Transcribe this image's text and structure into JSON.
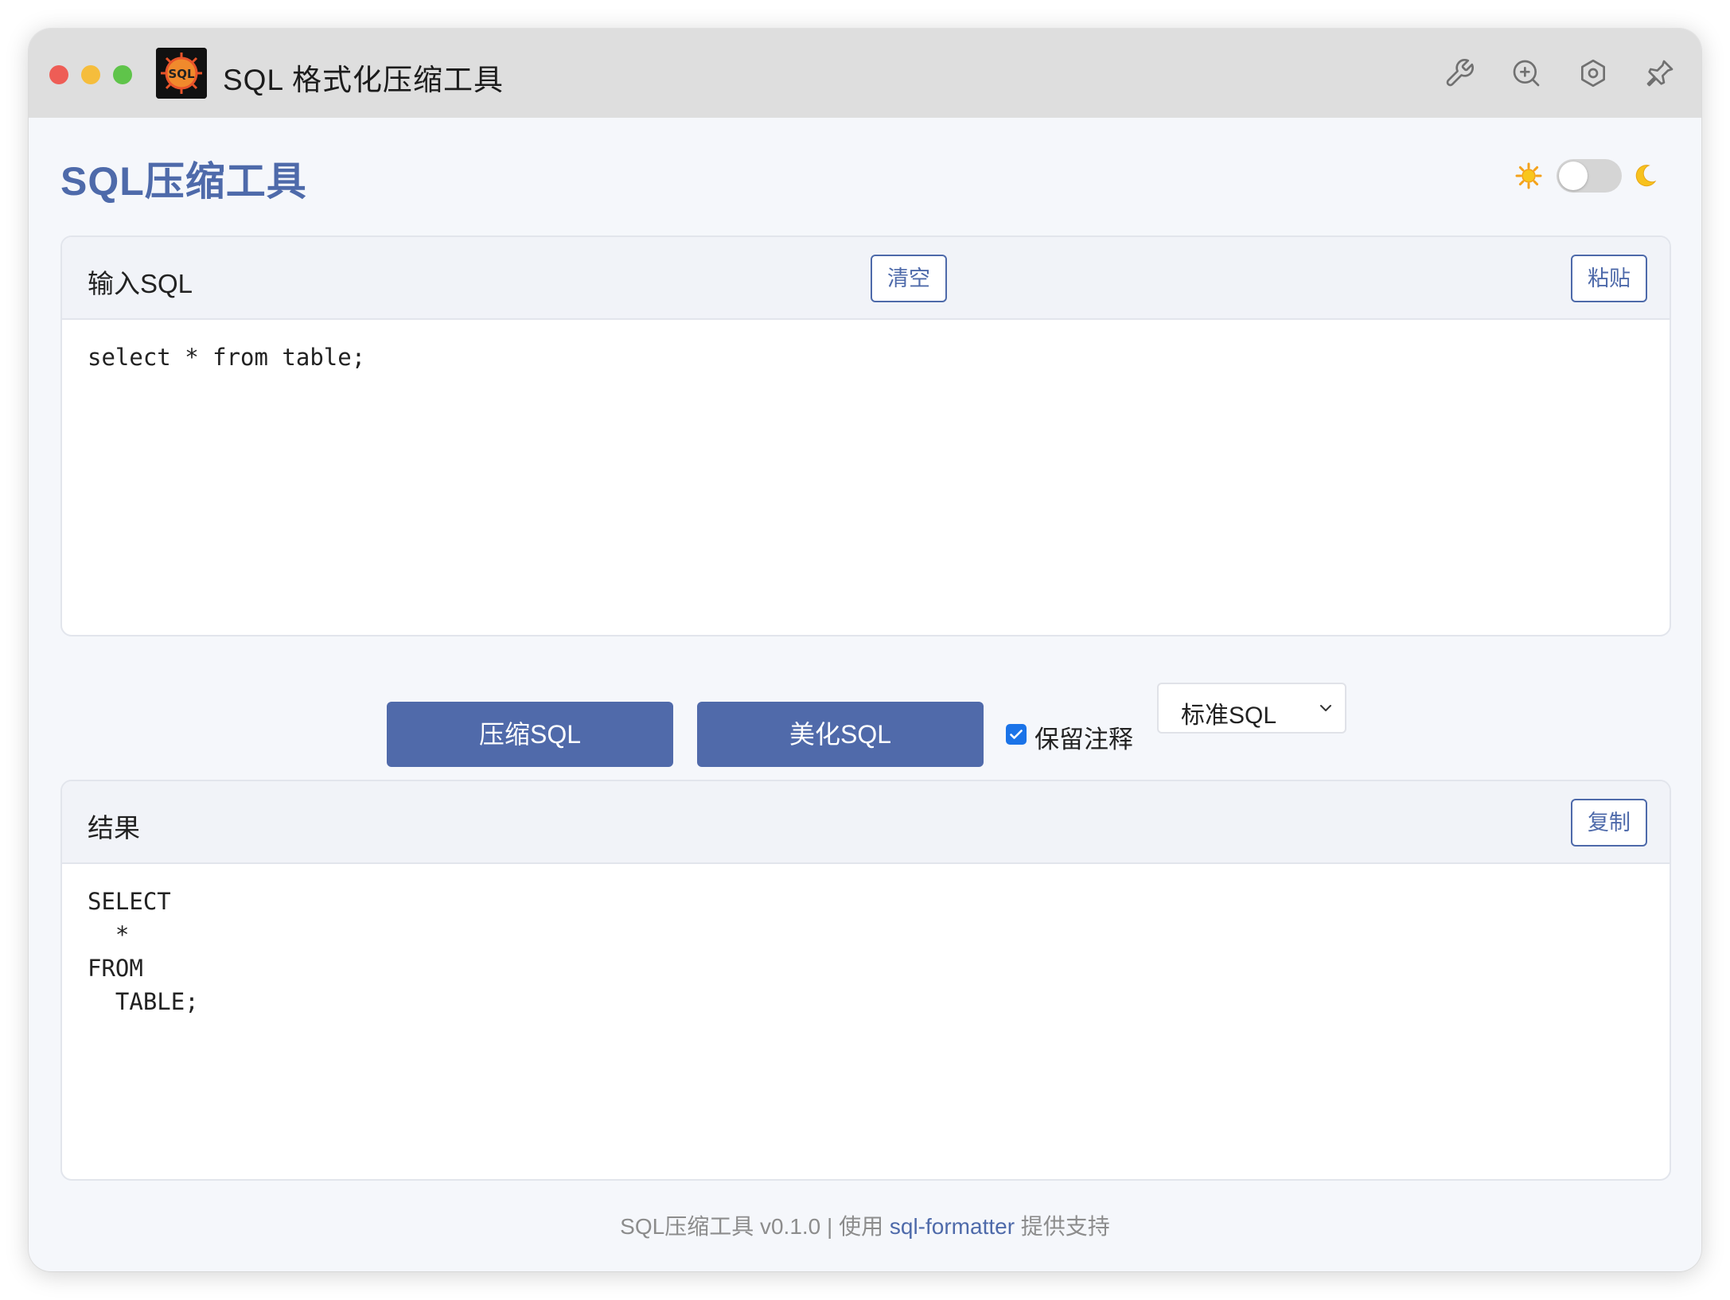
{
  "window": {
    "app_title": "SQL 格式化压缩工具",
    "toolbar_icons": [
      "wrench-icon",
      "zoom-in-icon",
      "settings-icon",
      "pin-icon"
    ]
  },
  "header": {
    "heading": "SQL压缩工具",
    "theme_toggle": {
      "state": "light",
      "light_icon": "sun-icon",
      "dark_icon": "moon-icon"
    }
  },
  "input_panel": {
    "title": "输入SQL",
    "clear_label": "清空",
    "paste_label": "粘贴",
    "value": "select * from table;"
  },
  "actions": {
    "compress_label": "压缩SQL",
    "beautify_label": "美化SQL",
    "keep_comments_label": "保留注释",
    "keep_comments_checked": true,
    "dialect_selected": "标准SQL"
  },
  "result_panel": {
    "title": "结果",
    "copy_label": "复制",
    "value": "SELECT\n  *\nFROM\n  TABLE;"
  },
  "footer": {
    "prefix": "SQL压缩工具 v0.1.0 | 使用 ",
    "link": "sql-formatter",
    "suffix": " 提供支持"
  },
  "colors": {
    "accent": "#506aaa",
    "heading": "#4e6aaa",
    "titlebar": "#dedede",
    "background": "#f5f7fb"
  }
}
